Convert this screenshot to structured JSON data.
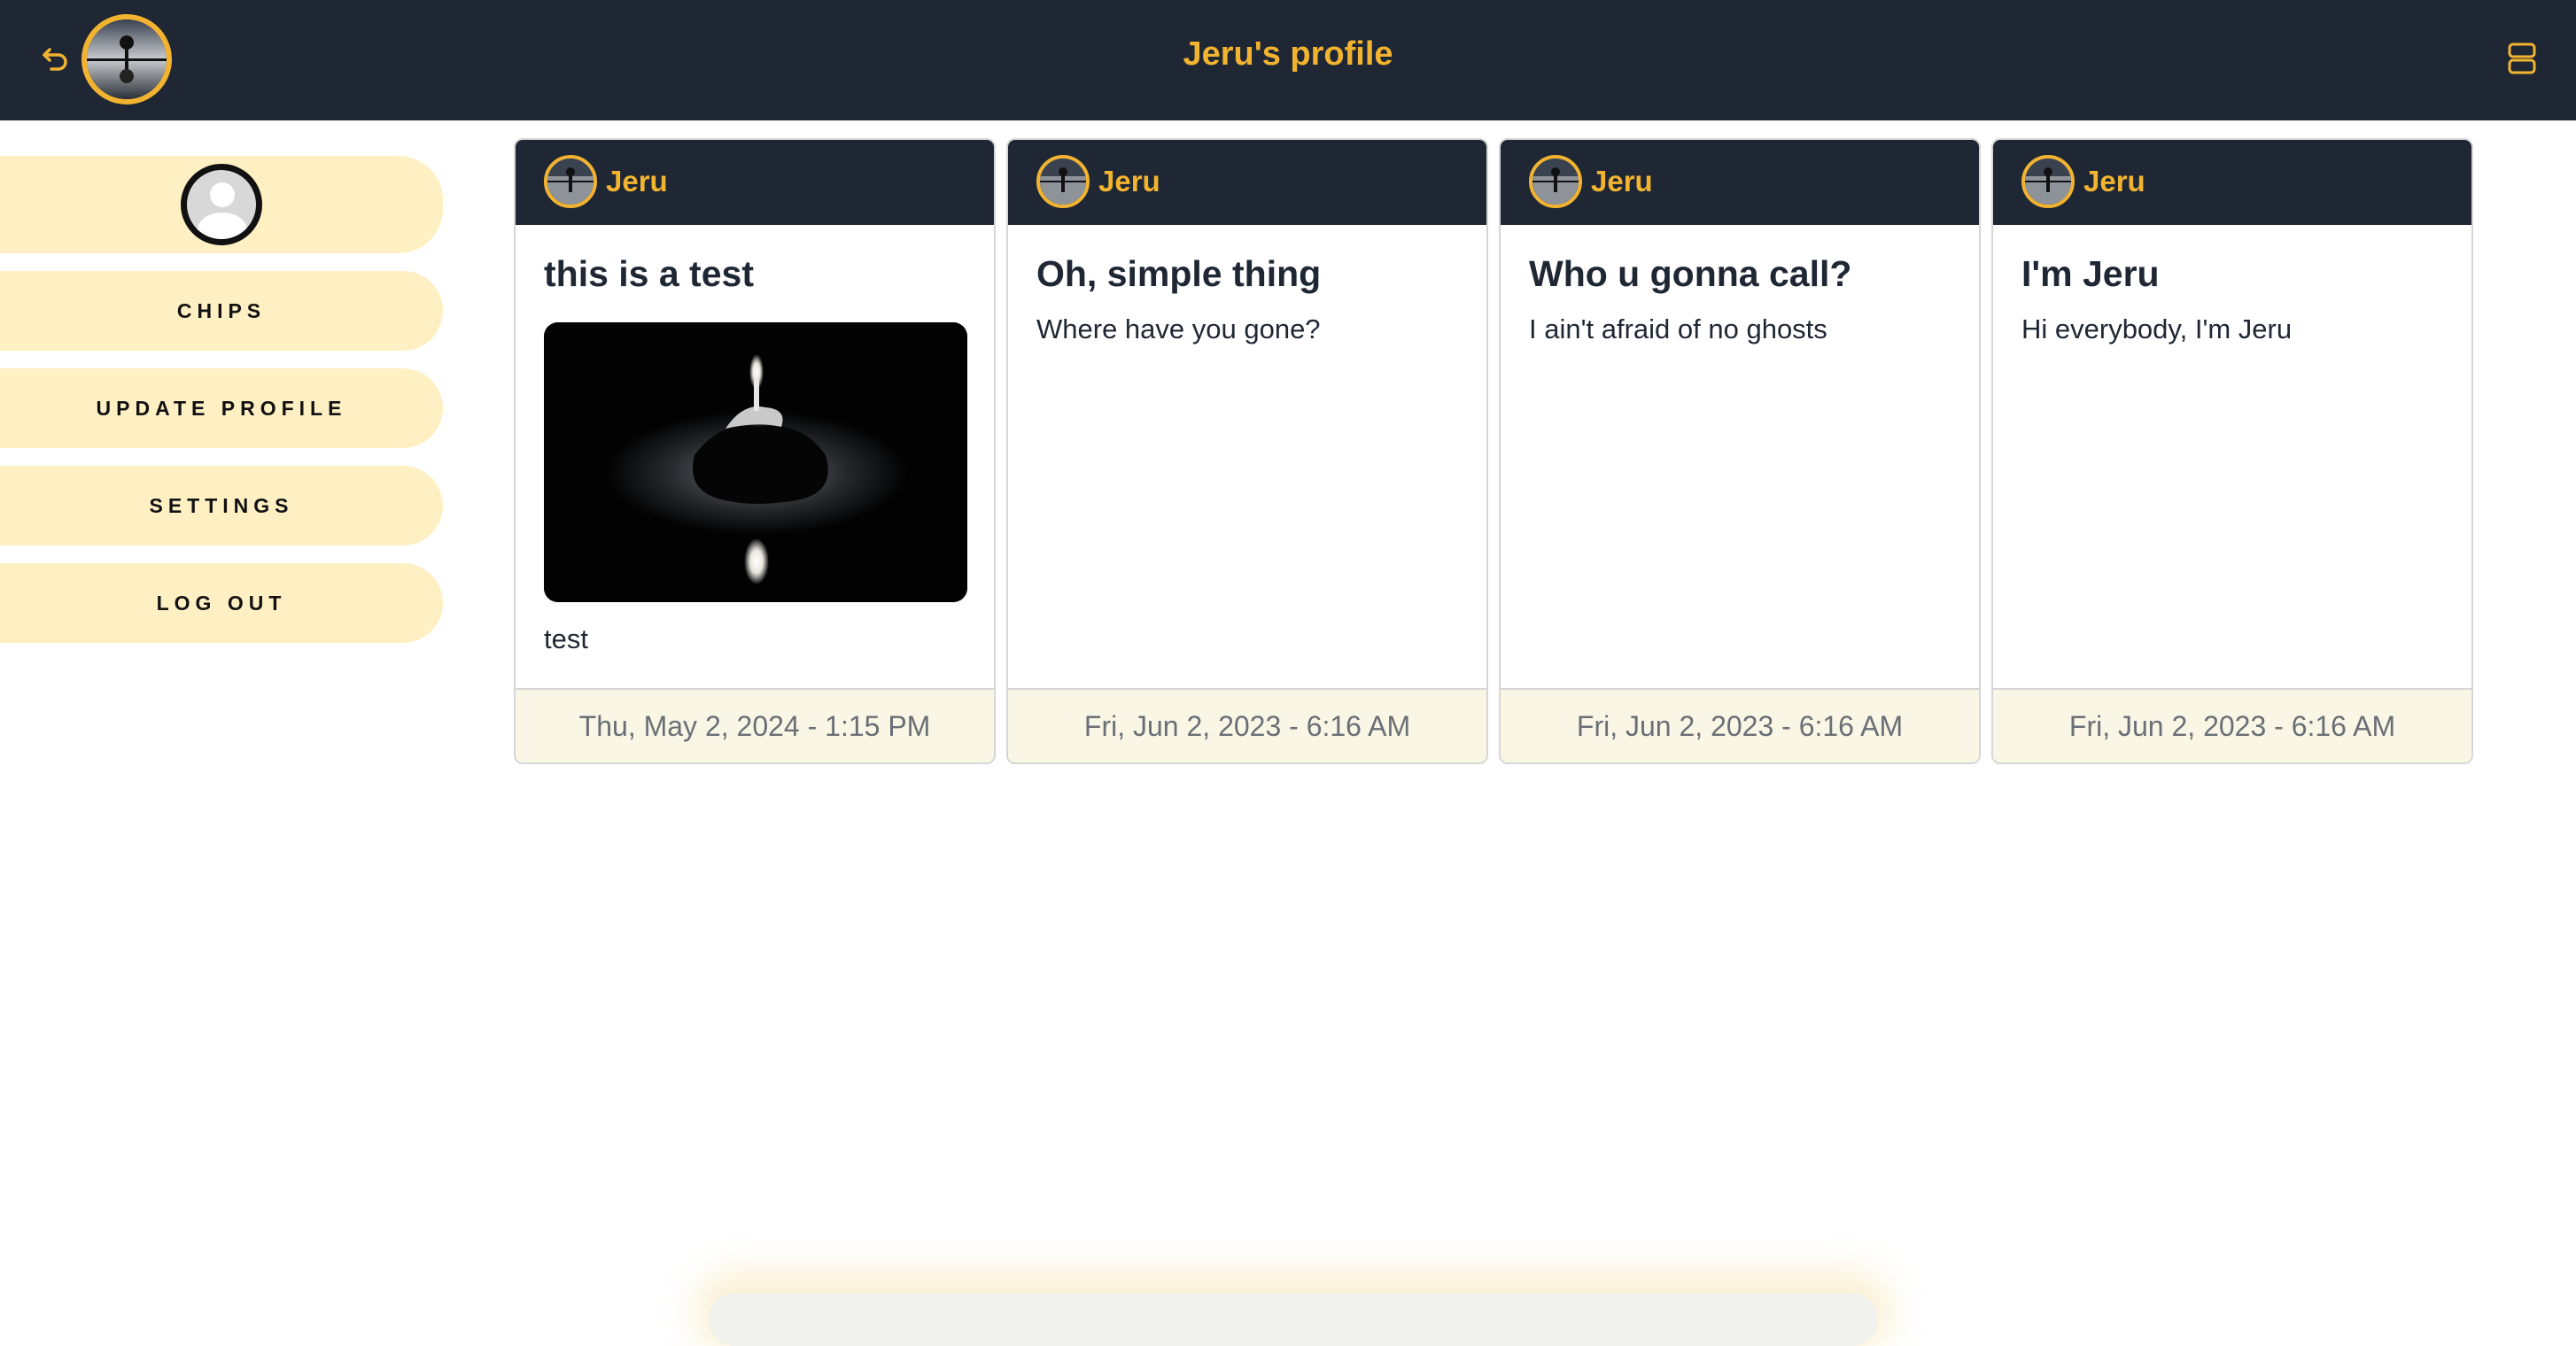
{
  "header": {
    "title": "Jeru's profile",
    "accent_color": "#f2b430",
    "background_color": "#1e2733",
    "back_icon": "undo-arrow-icon",
    "menu_icon": "layout-rows-icon"
  },
  "sidebar": {
    "avatar_icon": "default-user-icon",
    "items": [
      {
        "label": "CHIPS"
      },
      {
        "label": "UPDATE PROFILE"
      },
      {
        "label": "SETTINGS"
      },
      {
        "label": "LOG OUT"
      }
    ]
  },
  "posts": [
    {
      "author": "Jeru",
      "title": "this is a test",
      "body": "test",
      "has_image": true,
      "date": "Thu, May 2, 2024 - 1:15 PM"
    },
    {
      "author": "Jeru",
      "title": "Oh, simple thing",
      "body": "Where have you gone?",
      "has_image": false,
      "date": "Fri, Jun 2, 2023 - 6:16 AM"
    },
    {
      "author": "Jeru",
      "title": "Who u gonna call?",
      "body": "I ain't afraid of no ghosts",
      "has_image": false,
      "date": "Fri, Jun 2, 2023 - 6:16 AM"
    },
    {
      "author": "Jeru",
      "title": "I'm Jeru",
      "body": "Hi everybody, I'm Jeru",
      "has_image": false,
      "date": "Fri, Jun 2, 2023 - 6:16 AM"
    }
  ]
}
